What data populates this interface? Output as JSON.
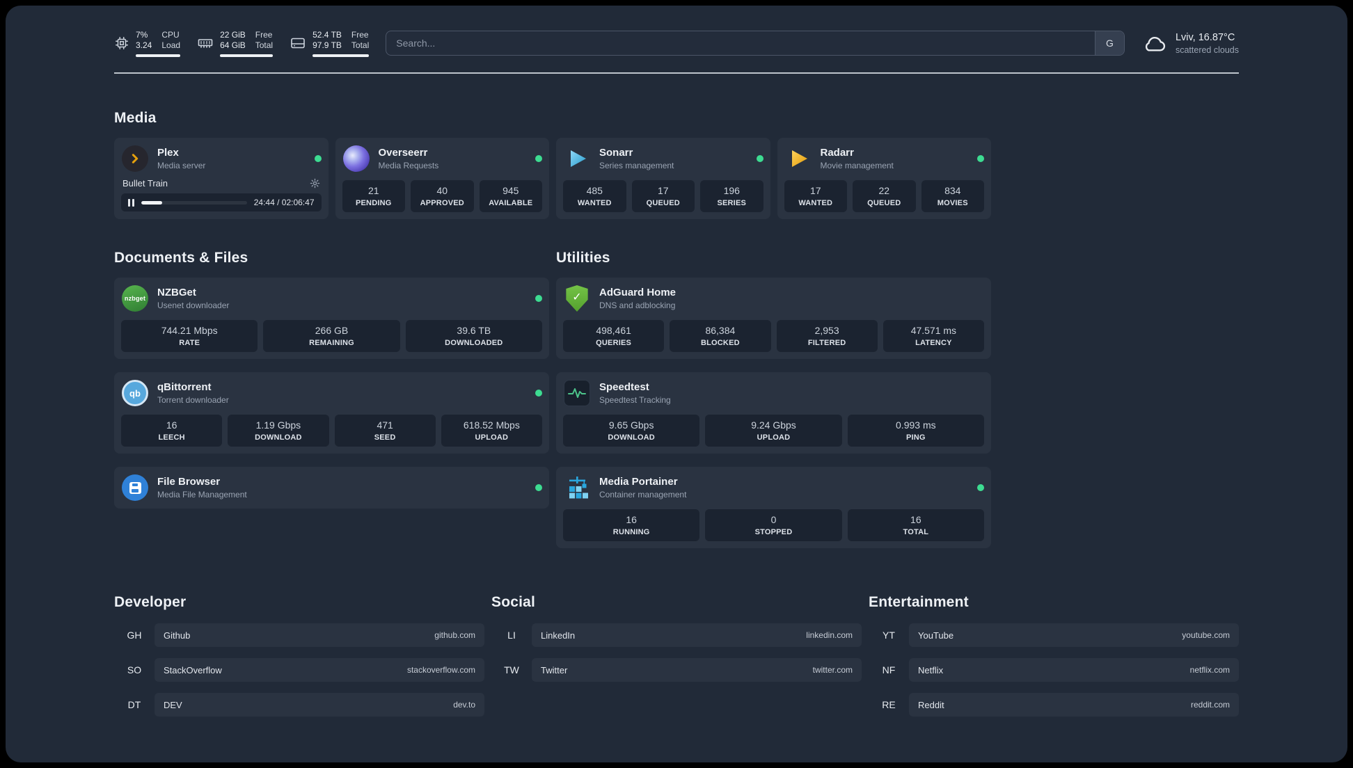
{
  "topbar": {
    "cpu": {
      "icon": "cpu-chip-icon",
      "percent": "7%",
      "load": "3.24",
      "label_top": "CPU",
      "label_bottom": "Load"
    },
    "memory": {
      "icon": "ram-icon",
      "free": "22 GiB",
      "total": "64 GiB",
      "label_top": "Free",
      "label_bottom": "Total"
    },
    "disk": {
      "icon": "hard-drive-icon",
      "free": "52.4 TB",
      "total": "97.9 TB",
      "label_top": "Free",
      "label_bottom": "Total"
    },
    "search": {
      "placeholder": "Search...",
      "provider_button": "G"
    },
    "weather": {
      "icon": "cloud-icon",
      "location": "Lviv, 16.87°C",
      "condition": "scattered clouds"
    }
  },
  "sections": {
    "media": "Media",
    "documents": "Documents & Files",
    "utilities": "Utilities",
    "developer": "Developer",
    "social": "Social",
    "entertainment": "Entertainment"
  },
  "services": {
    "plex": {
      "name": "Plex",
      "subtitle": "Media server",
      "status": "online",
      "now_playing": {
        "title": "Bullet Train",
        "time": "24:44 / 02:06:47",
        "progress_percent": 19.6
      }
    },
    "overseerr": {
      "name": "Overseerr",
      "subtitle": "Media Requests",
      "status": "online",
      "stats": [
        {
          "value": "21",
          "label": "PENDING"
        },
        {
          "value": "40",
          "label": "APPROVED"
        },
        {
          "value": "945",
          "label": "AVAILABLE"
        }
      ]
    },
    "sonarr": {
      "name": "Sonarr",
      "subtitle": "Series management",
      "status": "online",
      "stats": [
        {
          "value": "485",
          "label": "WANTED"
        },
        {
          "value": "17",
          "label": "QUEUED"
        },
        {
          "value": "196",
          "label": "SERIES"
        }
      ]
    },
    "radarr": {
      "name": "Radarr",
      "subtitle": "Movie management",
      "status": "online",
      "stats": [
        {
          "value": "17",
          "label": "WANTED"
        },
        {
          "value": "22",
          "label": "QUEUED"
        },
        {
          "value": "834",
          "label": "MOVIES"
        }
      ]
    },
    "nzbget": {
      "name": "NZBGet",
      "subtitle": "Usenet downloader",
      "status": "online",
      "icon_text": "nzbget",
      "stats": [
        {
          "value": "744.21 Mbps",
          "label": "RATE"
        },
        {
          "value": "266 GB",
          "label": "REMAINING"
        },
        {
          "value": "39.6 TB",
          "label": "DOWNLOADED"
        }
      ]
    },
    "qbittorrent": {
      "name": "qBittorrent",
      "subtitle": "Torrent downloader",
      "status": "online",
      "icon_text": "qb",
      "stats": [
        {
          "value": "16",
          "label": "LEECH"
        },
        {
          "value": "1.19 Gbps",
          "label": "DOWNLOAD"
        },
        {
          "value": "471",
          "label": "SEED"
        },
        {
          "value": "618.52 Mbps",
          "label": "UPLOAD"
        }
      ]
    },
    "filebrowser": {
      "name": "File Browser",
      "subtitle": "Media File Management",
      "status": "online"
    },
    "adguard": {
      "name": "AdGuard Home",
      "subtitle": "DNS and adblocking",
      "stats": [
        {
          "value": "498,461",
          "label": "QUERIES"
        },
        {
          "value": "86,384",
          "label": "BLOCKED"
        },
        {
          "value": "2,953",
          "label": "FILTERED"
        },
        {
          "value": "47.571 ms",
          "label": "LATENCY"
        }
      ]
    },
    "speedtest": {
      "name": "Speedtest",
      "subtitle": "Speedtest Tracking",
      "stats": [
        {
          "value": "9.65 Gbps",
          "label": "DOWNLOAD"
        },
        {
          "value": "9.24 Gbps",
          "label": "UPLOAD"
        },
        {
          "value": "0.993 ms",
          "label": "PING"
        }
      ]
    },
    "portainer": {
      "name": "Media Portainer",
      "subtitle": "Container management",
      "status": "online",
      "stats": [
        {
          "value": "16",
          "label": "RUNNING"
        },
        {
          "value": "0",
          "label": "STOPPED"
        },
        {
          "value": "16",
          "label": "TOTAL"
        }
      ]
    }
  },
  "bookmarks": {
    "developer": [
      {
        "abbr": "GH",
        "label": "Github",
        "url": "github.com"
      },
      {
        "abbr": "SO",
        "label": "StackOverflow",
        "url": "stackoverflow.com"
      },
      {
        "abbr": "DT",
        "label": "DEV",
        "url": "dev.to"
      }
    ],
    "social": [
      {
        "abbr": "LI",
        "label": "LinkedIn",
        "url": "linkedin.com"
      },
      {
        "abbr": "TW",
        "label": "Twitter",
        "url": "twitter.com"
      }
    ],
    "entertainment": [
      {
        "abbr": "YT",
        "label": "YouTube",
        "url": "youtube.com"
      },
      {
        "abbr": "NF",
        "label": "Netflix",
        "url": "netflix.com"
      },
      {
        "abbr": "RE",
        "label": "Reddit",
        "url": "reddit.com"
      }
    ]
  },
  "colors": {
    "background": "#212a38",
    "card": "#2a3341",
    "stat_tile": "#1b2330",
    "status_online": "#3ddc91",
    "plex_accent": "#e5a00d",
    "sonarr_accent": "#35b5e8",
    "radarr_accent": "#f0ad0e",
    "overseerr_accent": "#6c5ce7",
    "nzbget_accent": "#3f9e42",
    "qbittorrent_accent": "#57a8dd",
    "filebrowser_accent": "#2f81d8",
    "adguard_accent": "#68b32e",
    "speedtest_accent": "#4cc38a",
    "portainer_accent": "#2aa7de"
  }
}
